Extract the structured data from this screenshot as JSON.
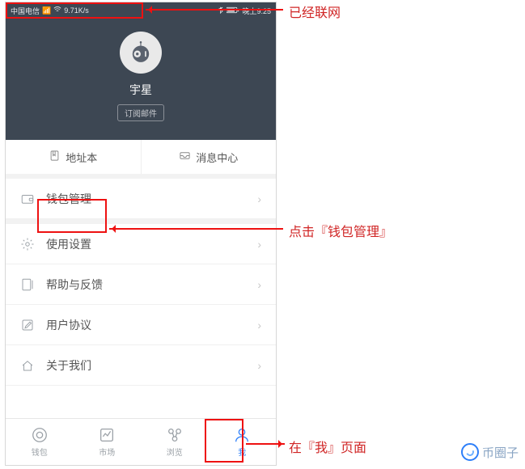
{
  "status": {
    "carrier": "中国电信",
    "speed": "9.71K/s",
    "time": "晚上9:25"
  },
  "profile": {
    "username": "宇星",
    "sub_btn": "订阅邮件"
  },
  "quick": {
    "address_book": "地址本",
    "message_center": "消息中心"
  },
  "menu": {
    "wallet_manage": "钱包管理",
    "settings": "使用设置",
    "help": "帮助与反馈",
    "agreement": "用户协议",
    "about": "关于我们"
  },
  "nav": {
    "wallet": "钱包",
    "market": "市场",
    "browse": "浏览",
    "me": "我"
  },
  "annotations": {
    "networked": "已经联网",
    "click_wallet": "点击『钱包管理』",
    "on_me_page": "在『我』页面"
  },
  "watermark": "币圈子"
}
